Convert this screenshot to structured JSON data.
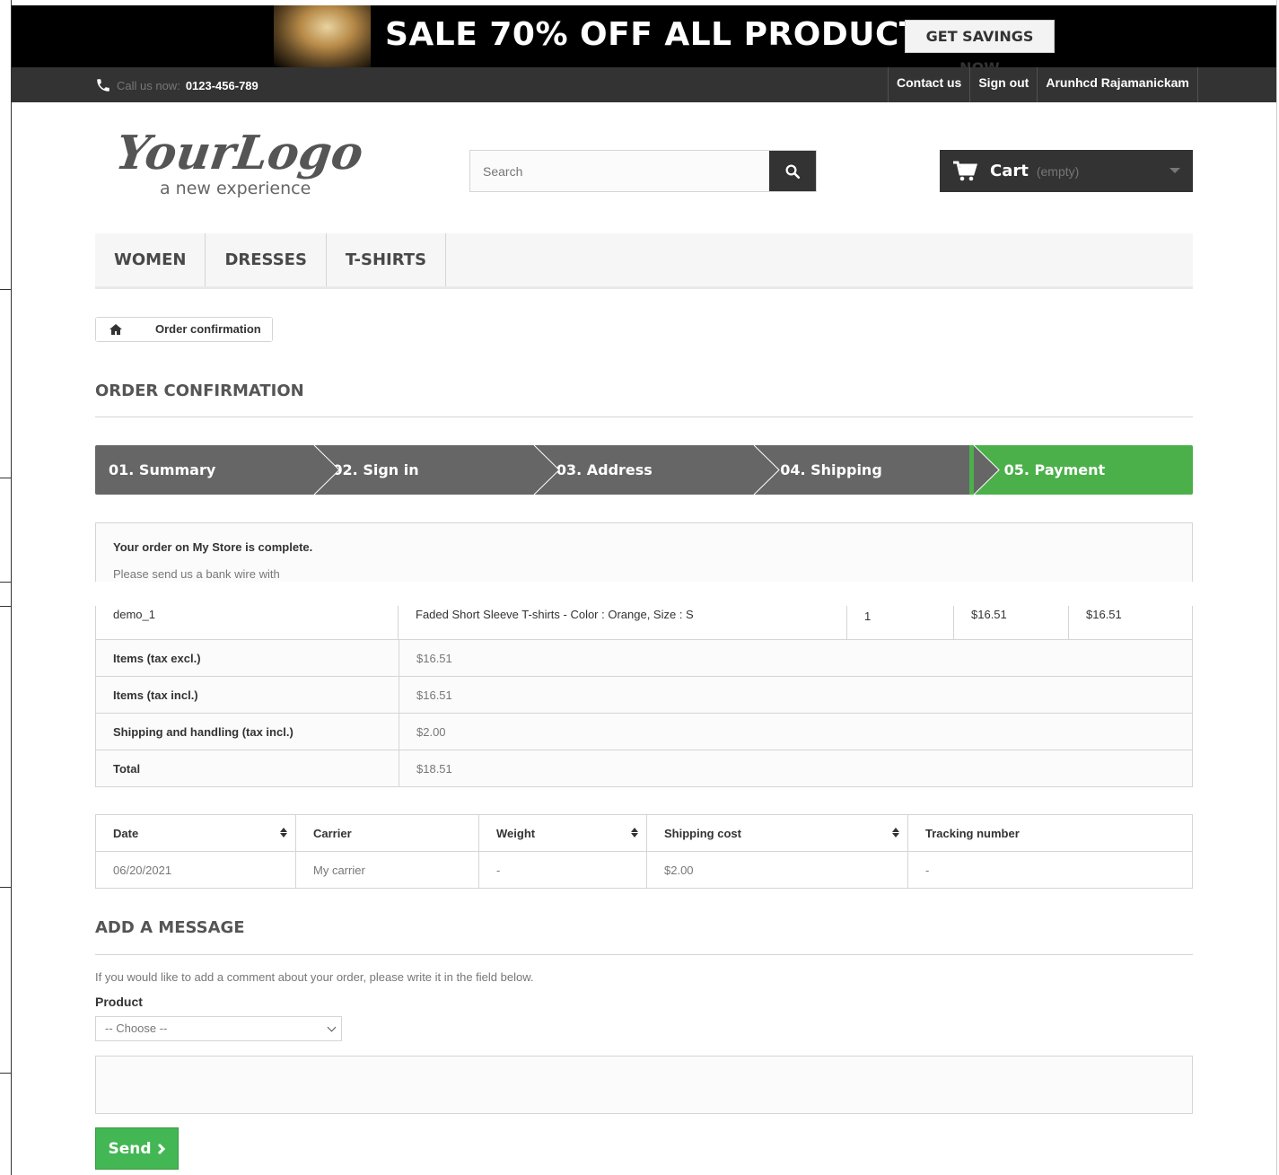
{
  "banner": {
    "text": "SALE 70% OFF ALL PRODUCTS",
    "button": "GET SAVINGS NOW"
  },
  "topbar": {
    "call_label": "Call us now:",
    "phone": "0123-456-789",
    "links": [
      "Contact us",
      "Sign out",
      "Arunhcd Rajamanickam"
    ]
  },
  "header": {
    "logo_text": "YourLogo",
    "logo_tagline": "a new experience",
    "search_placeholder": "Search",
    "cart_label": "Cart",
    "cart_status": "(empty)"
  },
  "menu": [
    "WOMEN",
    "DRESSES",
    "T-SHIRTS"
  ],
  "breadcrumb": {
    "current": "Order confirmation"
  },
  "page_title": "ORDER CONFIRMATION",
  "steps": [
    "01. Summary",
    "02. Sign in",
    "03. Address",
    "04. Shipping",
    "05. Payment"
  ],
  "order_notice": {
    "line1": "Your order on My Store is complete.",
    "line2": "Please send us a bank wire with"
  },
  "product_row": {
    "reference": "demo_1",
    "name": "Faded Short Sleeve T-shirts - Color : Orange, Size : S",
    "quantity": "1",
    "unit_price": "$16.51",
    "total": "$16.51"
  },
  "totals": [
    {
      "label": "Items (tax excl.)",
      "value": "$16.51"
    },
    {
      "label": "Items (tax incl.)",
      "value": "$16.51"
    },
    {
      "label": "Shipping and handling (tax incl.)",
      "value": "$2.00"
    },
    {
      "label": "Total",
      "value": "$18.51"
    }
  ],
  "shipping_table": {
    "headers": [
      "Date",
      "Carrier",
      "Weight",
      "Shipping cost",
      "Tracking number"
    ],
    "row": [
      "06/20/2021",
      "My carrier",
      "-",
      "$2.00",
      "-"
    ]
  },
  "message": {
    "title": "ADD A MESSAGE",
    "help": "If you would like to add a comment about your order, please write it in the field below.",
    "product_label": "Product",
    "select_value": "-- Choose --",
    "send": "Send"
  },
  "colors": {
    "accent_green": "#4bb04a",
    "dark": "#333333",
    "step_gray": "#666666"
  }
}
